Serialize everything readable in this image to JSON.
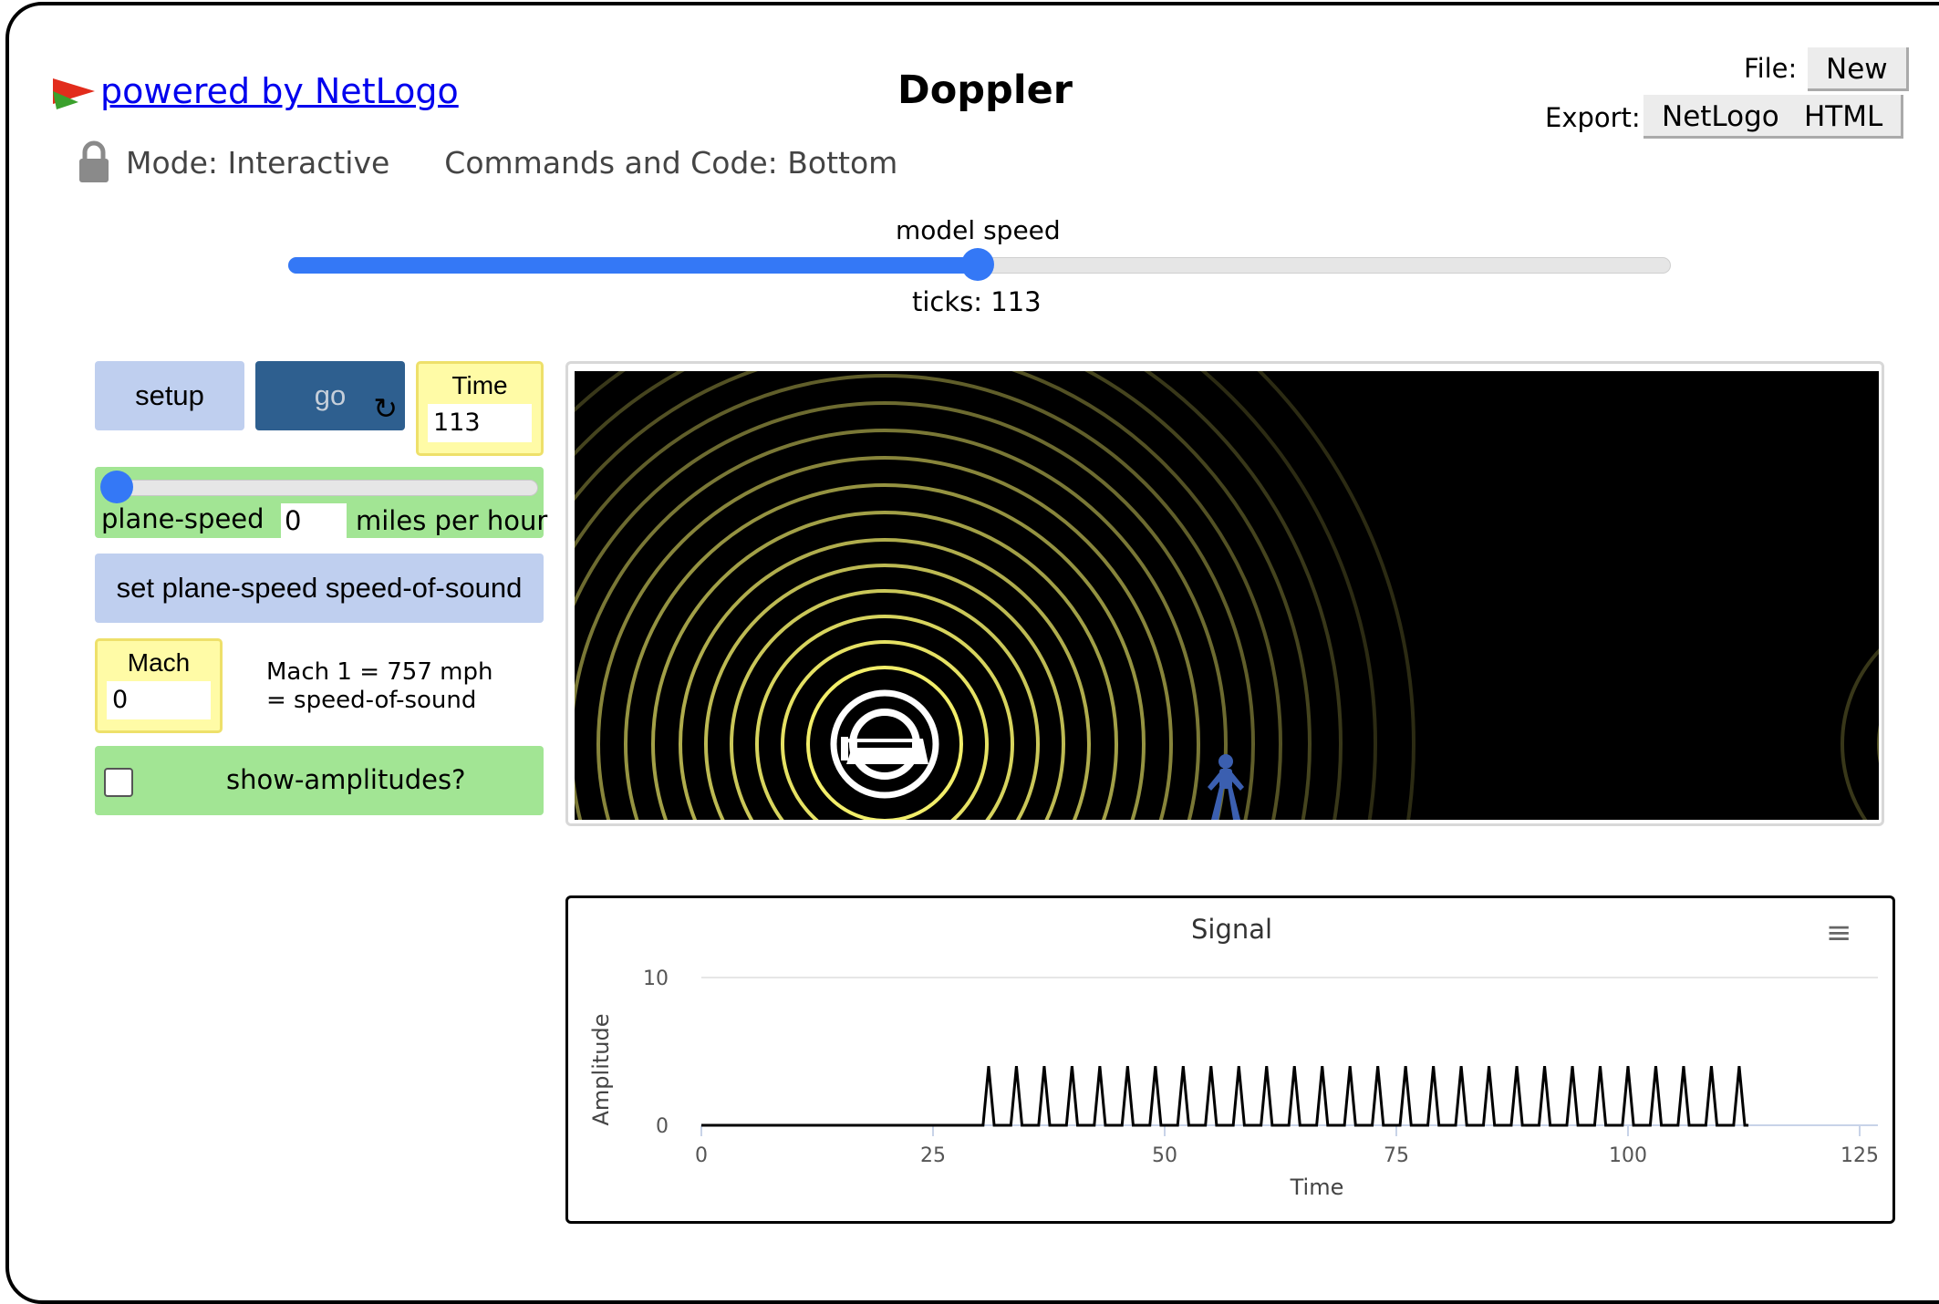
{
  "header": {
    "powered_by": "powered by NetLogo",
    "title": "Doppler",
    "file_label": "File:",
    "new_button": "New",
    "export_label": "Export:",
    "export_netlogo": "NetLogo",
    "export_html": "HTML",
    "mode": "Mode: Interactive",
    "commands": "Commands and Code: Bottom"
  },
  "speed": {
    "label": "model speed",
    "ticks": "ticks: 113",
    "value": 0.5
  },
  "widgets": {
    "setup": "setup",
    "go": "go",
    "time_label": "Time",
    "time_value": "113",
    "plane_speed_label": "plane-speed",
    "plane_speed_value": "0",
    "plane_speed_units": "miles per hour",
    "set_button": "set plane-speed speed-of-sound",
    "mach_label": "Mach",
    "mach_value": "0",
    "note_line1": "Mach 1 = 757 mph",
    "note_line2": "= speed-of-sound",
    "show_amplitudes": "show-amplitudes?"
  },
  "colors": {
    "accent": "#3478f6",
    "button": "#bfcfef",
    "go_button": "#2e5f8f",
    "slider_bg": "#a2e594",
    "monitor_bg": "#fffba6",
    "wave": "#f2ee6a",
    "person": "#3b5fb0"
  },
  "chart_data": {
    "type": "line",
    "title": "Signal",
    "xlabel": "Time",
    "ylabel": "Amplitude",
    "xlim": [
      0,
      125
    ],
    "ylim": [
      0,
      10
    ],
    "x_ticks": [
      0,
      25,
      50,
      75,
      100,
      125
    ],
    "y_ticks": [
      0,
      10
    ],
    "series": [
      {
        "pulse_times": [
          31,
          34,
          37,
          40,
          43,
          46,
          49,
          52,
          55,
          58,
          61,
          64,
          67,
          70,
          73,
          76,
          79,
          82,
          85,
          88,
          91,
          94,
          97,
          100,
          103,
          106,
          109,
          112
        ],
        "pulse_height": 4,
        "end": 113
      }
    ]
  }
}
